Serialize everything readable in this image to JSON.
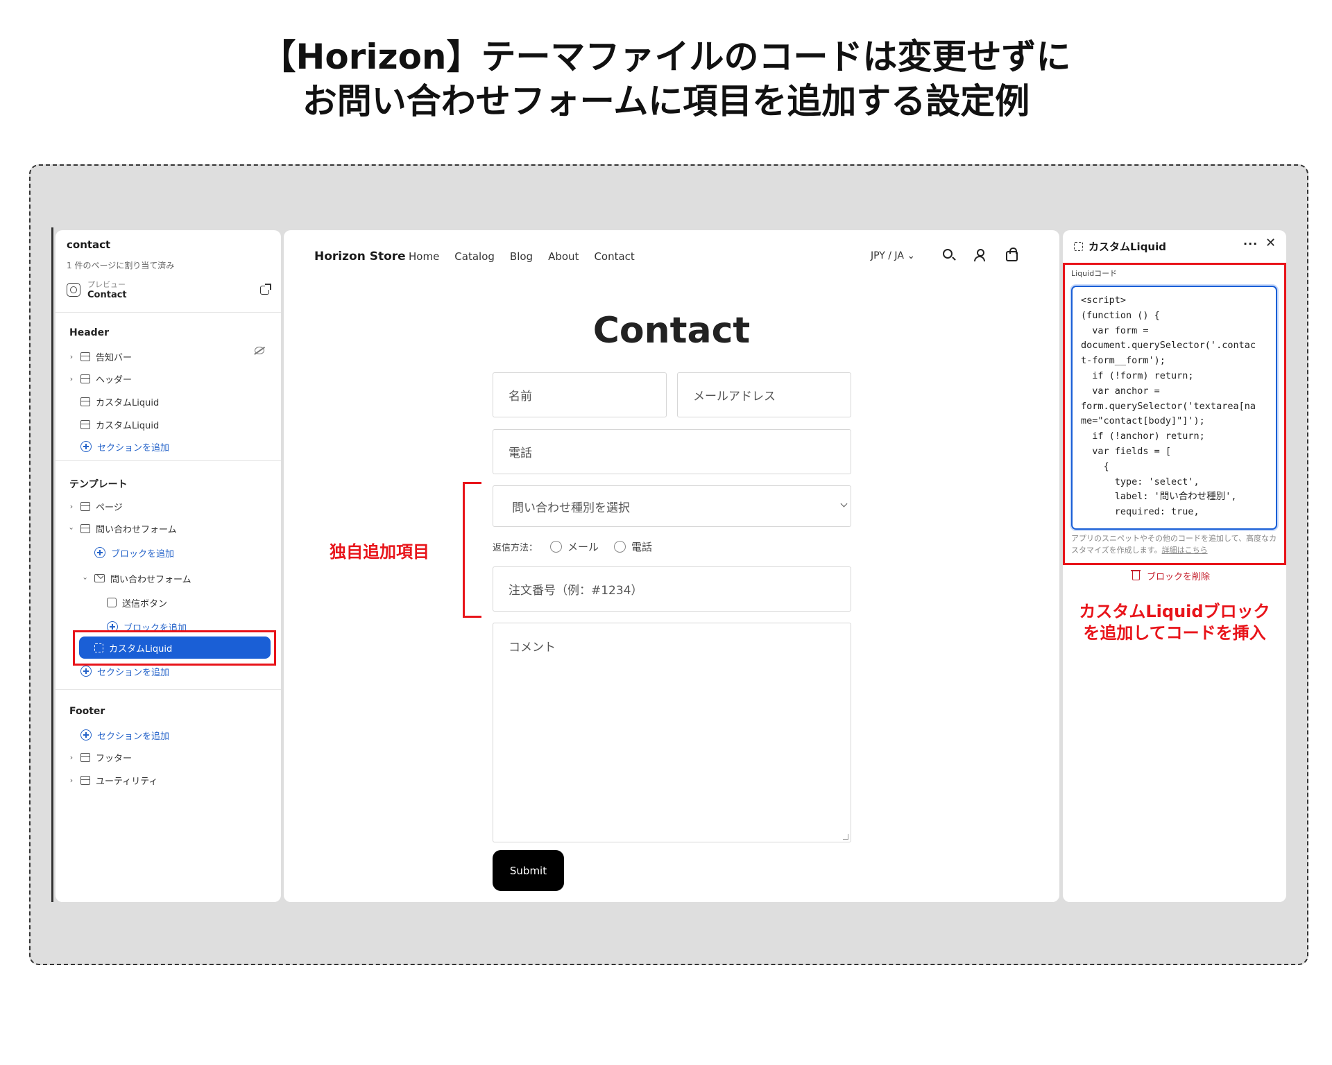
{
  "page": {
    "title_line1": "【Horizon】テーマファイルのコードは変更せずに",
    "title_line2": "お問い合わせフォームに項目を追加する設定例"
  },
  "sidebar": {
    "title": "contact",
    "subtitle": "1 件のページに割り当て済み",
    "preview_label": "プレビュー",
    "preview_value": "Contact",
    "header_heading": "Header",
    "header_items": [
      "告知バー",
      "ヘッダー",
      "カスタムLiquid",
      "カスタムLiquid"
    ],
    "add_section": "セクションを追加",
    "template_heading": "テンプレート",
    "template_items": [
      "ページ",
      "問い合わせフォーム"
    ],
    "add_block": "ブロックを追加",
    "form_block": "問い合わせフォーム",
    "submit_block": "送信ボタン",
    "selected_block": "カスタムLiquid",
    "footer_heading": "Footer",
    "footer_items": [
      "フッター",
      "ユーティリティ"
    ]
  },
  "store": {
    "brand": "Horizon Store",
    "nav": [
      "Home",
      "Catalog",
      "Blog",
      "About",
      "Contact"
    ],
    "locale": "JPY / JA ⌄",
    "heading": "Contact",
    "fields": {
      "name": "名前",
      "email": "メールアドレス",
      "phone": "電話",
      "inquiry_type": "問い合わせ種別を選択",
      "reply_label": "返信方法：",
      "reply_options": [
        "メール",
        "電話"
      ],
      "order_number": "注文番号（例：#1234）",
      "comment": "コメント"
    },
    "submit": "Submit"
  },
  "annotations": {
    "custom_fields": "独自追加項目",
    "right_line1": "カスタムLiquidブロック",
    "right_line2": "を追加してコードを挿入"
  },
  "panel": {
    "title": "カスタムLiquid",
    "more": "···",
    "close": "✕",
    "code_label": "Liquidコード",
    "code_lines": [
      "<script>",
      "(function () {",
      "  var form =",
      "document.querySelector('.contac",
      "t-form__form');",
      "  if (!form) return;",
      "  var anchor =",
      "form.querySelector('textarea[na",
      "me=\"contact[body]\"]');",
      "  if (!anchor) return;",
      "",
      "  var fields = [",
      "    {",
      "      type: 'select',",
      "      label: '問い合わせ種別',",
      "      required: true,"
    ],
    "help_text": "アプリのスニペットやその他のコードを追加して、高度なカスタマイズを作成します。",
    "help_link": "詳細はこちら",
    "delete_block": "ブロックを削除"
  }
}
